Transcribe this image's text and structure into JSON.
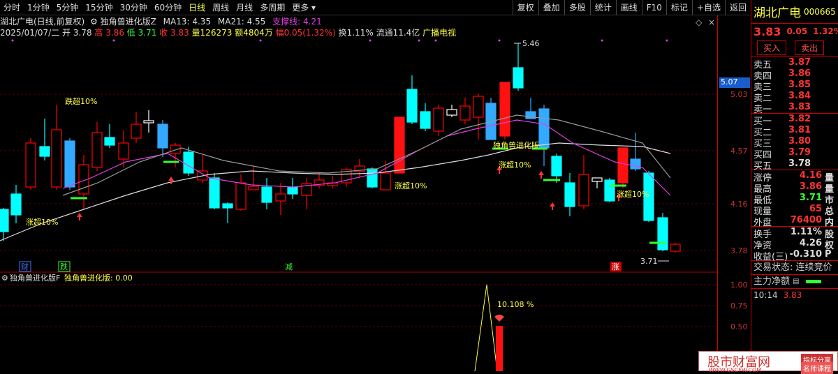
{
  "periods": [
    "分时",
    "1分钟",
    "5分钟",
    "15分钟",
    "30分钟",
    "60分钟",
    "日线",
    "周线",
    "月线",
    "多周期",
    "更多"
  ],
  "active_period": "日线",
  "tools": [
    "复权",
    "叠加",
    "多股",
    "统计",
    "画线",
    "F10",
    "标记",
    "+自选",
    "返回"
  ],
  "stock": {
    "name": "湖北广电",
    "code": "000665",
    "price": "3.83",
    "change": "0.05",
    "change_pct": "1.32%"
  },
  "info_line1": {
    "name_mode": "湖北广电(日线,前复权)",
    "indicator": "独角兽进化版Z",
    "ma13": "MA13: 4.35",
    "ma21": "MA21: 4.55",
    "support": "支撑线: 4.21"
  },
  "info_line2": {
    "date": "2025/01/07/二",
    "open": "开 3.78",
    "high": "高 3.86",
    "low": "低 3.71",
    "close": "收 3.83",
    "vol": "量126273",
    "amount": "额4804万",
    "amp": "幅0.05(1.32%)",
    "turnover": "换1.11%",
    "float_cap": "流通11.4亿",
    "sector": "广播电视"
  },
  "chart_data": {
    "type": "candlestick",
    "y_ticks": [
      "5.03",
      "4.57",
      "4.16",
      "3.78"
    ],
    "price_highlight": "5.07",
    "high_label": "5.46",
    "low_label": "3.71",
    "annotations": [
      "跌超10%",
      "涨超10%",
      "涨超10%",
      "涨超10%",
      "独角兽进化版",
      "涨超10%"
    ],
    "bottom_markers": [
      "财",
      "跌",
      "减",
      "涨"
    ]
  },
  "sub_panel": {
    "title": "独角兽进化版F",
    "value_label": "独角兽进化版: 0.00",
    "y_ticks": [
      "1.00",
      "0.75",
      "0.50"
    ],
    "peak_label": "10.108 %"
  },
  "quote": {
    "buy_btn": "买入",
    "sell_btn": "卖出",
    "asks": [
      {
        "label": "卖五",
        "price": "3.87"
      },
      {
        "label": "卖四",
        "price": "3.86"
      },
      {
        "label": "卖三",
        "price": "3.85"
      },
      {
        "label": "卖二",
        "price": "3.84"
      },
      {
        "label": "卖一",
        "price": "3.83"
      }
    ],
    "bids": [
      {
        "label": "买一",
        "price": "3.82"
      },
      {
        "label": "买二",
        "price": "3.81"
      },
      {
        "label": "买三",
        "price": "3.80"
      },
      {
        "label": "买四",
        "price": "3.79"
      },
      {
        "label": "买五",
        "price": "3.78"
      }
    ],
    "stats1": [
      {
        "label": "涨停",
        "value": "4.16",
        "unit": "量"
      },
      {
        "label": "最高",
        "value": "3.86",
        "unit": "量"
      },
      {
        "label": "最低",
        "value": "3.71",
        "unit": "市"
      },
      {
        "label": "现量",
        "value": "65",
        "unit": "总"
      },
      {
        "label": "外盘",
        "value": "76400",
        "unit": "内"
      }
    ],
    "stats2": [
      {
        "label": "换手",
        "value": "1.11%",
        "unit": "股"
      },
      {
        "label": "净资",
        "value": "4.26",
        "unit": "权"
      },
      {
        "label": "收益(三)",
        "value": "-0.310",
        "unit": "P"
      }
    ],
    "trade_status": "交易状态: 连续竞价",
    "main_net": "主力净额",
    "time": "10:14",
    "time_val": "3.83"
  },
  "watermark": {
    "main": "股市财富网",
    "sub": "WWW.GSCFW.COM",
    "tag1": "指标分享",
    "tag2": "名师课程"
  }
}
